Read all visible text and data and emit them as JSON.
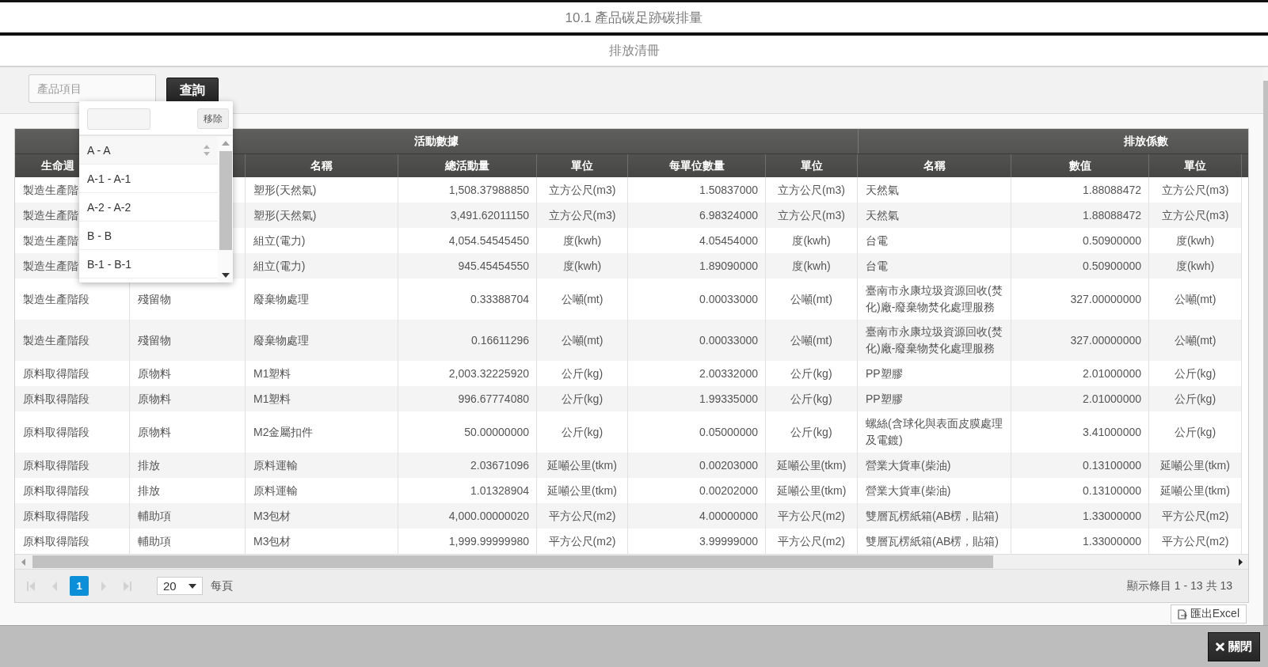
{
  "title_bar": {
    "title": "10.1 產品碳足跡碳排量"
  },
  "section": {
    "title": "排放清冊"
  },
  "filter": {
    "product_field": {
      "placeholder": "產品項目"
    },
    "query_button": "查詢"
  },
  "product_dropdown": {
    "remove_button": "移除",
    "options": [
      {
        "label": "A - A",
        "selected": true
      },
      {
        "label": "A-1 - A-1",
        "selected": false
      },
      {
        "label": "A-2 - A-2",
        "selected": false
      },
      {
        "label": "B - B",
        "selected": false
      },
      {
        "label": "B-1 - B-1",
        "selected": false
      }
    ]
  },
  "table": {
    "column_groups": [
      "活動數據",
      "排放係數"
    ],
    "columns": {
      "stage": "生命週",
      "activity_name": "名稱",
      "total_activity": "總活動量",
      "activity_unit": "單位",
      "quantity_per_unit": "每單位數量",
      "quantity_unit": "單位",
      "factor_name": "名稱",
      "factor_value": "數值",
      "factor_unit": "單位"
    },
    "rows": [
      {
        "stage": "製造生產階",
        "activity_name": "塑形(天然氣)",
        "total_activity": "1,508.37988850",
        "activity_unit": "立方公尺(m3)",
        "quantity_per_unit": "1.50837000",
        "quantity_unit": "立方公尺(m3)",
        "factor_name": "天然氣",
        "factor_value": "1.88088472",
        "factor_unit": "立方公尺(m3)"
      },
      {
        "stage": "製造生產階",
        "activity_name": "塑形(天然氣)",
        "total_activity": "3,491.62011150",
        "activity_unit": "立方公尺(m3)",
        "quantity_per_unit": "6.98324000",
        "quantity_unit": "立方公尺(m3)",
        "factor_name": "天然氣",
        "factor_value": "1.88088472",
        "factor_unit": "立方公尺(m3)"
      },
      {
        "stage": "製造生產階",
        "activity_name": "組立(電力)",
        "total_activity": "4,054.54545450",
        "activity_unit": "度(kwh)",
        "quantity_per_unit": "4.05454000",
        "quantity_unit": "度(kwh)",
        "factor_name": "台電",
        "factor_value": "0.50900000",
        "factor_unit": "度(kwh)"
      },
      {
        "stage": "製造生產階",
        "activity_name": "組立(電力)",
        "total_activity": "945.45454550",
        "activity_unit": "度(kwh)",
        "quantity_per_unit": "1.89090000",
        "quantity_unit": "度(kwh)",
        "factor_name": "台電",
        "factor_value": "0.50900000",
        "factor_unit": "度(kwh)"
      },
      {
        "stage": "製造生產階段",
        "column_2": "殘留物",
        "activity_name": "廢棄物處理",
        "total_activity": "0.33388704",
        "activity_unit": "公噸(mt)",
        "quantity_per_unit": "0.00033000",
        "quantity_unit": "公噸(mt)",
        "factor_name": "臺南市永康垃圾資源回收(焚化)廠-廢棄物焚化處理服務",
        "factor_value": "327.00000000",
        "factor_unit": "公噸(mt)"
      },
      {
        "stage": "製造生產階段",
        "column_2": "殘留物",
        "activity_name": "廢棄物處理",
        "total_activity": "0.16611296",
        "activity_unit": "公噸(mt)",
        "quantity_per_unit": "0.00033000",
        "quantity_unit": "公噸(mt)",
        "factor_name": "臺南市永康垃圾資源回收(焚化)廠-廢棄物焚化處理服務",
        "factor_value": "327.00000000",
        "factor_unit": "公噸(mt)"
      },
      {
        "stage": "原料取得階段",
        "column_2": "原物料",
        "activity_name": "M1塑料",
        "total_activity": "2,003.32225920",
        "activity_unit": "公斤(kg)",
        "quantity_per_unit": "2.00332000",
        "quantity_unit": "公斤(kg)",
        "factor_name": "PP塑膠",
        "factor_value": "2.01000000",
        "factor_unit": "公斤(kg)"
      },
      {
        "stage": "原料取得階段",
        "column_2": "原物料",
        "activity_name": "M1塑料",
        "total_activity": "996.67774080",
        "activity_unit": "公斤(kg)",
        "quantity_per_unit": "1.99335000",
        "quantity_unit": "公斤(kg)",
        "factor_name": "PP塑膠",
        "factor_value": "2.01000000",
        "factor_unit": "公斤(kg)"
      },
      {
        "stage": "原料取得階段",
        "column_2": "原物料",
        "activity_name": "M2金屬扣件",
        "total_activity": "50.00000000",
        "activity_unit": "公斤(kg)",
        "quantity_per_unit": "0.05000000",
        "quantity_unit": "公斤(kg)",
        "factor_name": "螺絲(含球化與表面皮膜處理及電鍍)",
        "factor_value": "3.41000000",
        "factor_unit": "公斤(kg)"
      },
      {
        "stage": "原料取得階段",
        "column_2": "排放",
        "activity_name": "原料運輸",
        "total_activity": "2.03671096",
        "activity_unit": "延噸公里(tkm)",
        "quantity_per_unit": "0.00203000",
        "quantity_unit": "延噸公里(tkm)",
        "factor_name": "營業大貨車(柴油)",
        "factor_value": "0.13100000",
        "factor_unit": "延噸公里(tkm)"
      },
      {
        "stage": "原料取得階段",
        "column_2": "排放",
        "activity_name": "原料運輸",
        "total_activity": "1.01328904",
        "activity_unit": "延噸公里(tkm)",
        "quantity_per_unit": "0.00202000",
        "quantity_unit": "延噸公里(tkm)",
        "factor_name": "營業大貨車(柴油)",
        "factor_value": "0.13100000",
        "factor_unit": "延噸公里(tkm)"
      },
      {
        "stage": "原料取得階段",
        "column_2": "輔助項",
        "activity_name": "M3包材",
        "total_activity": "4,000.00000020",
        "activity_unit": "平方公尺(m2)",
        "quantity_per_unit": "4.00000000",
        "quantity_unit": "平方公尺(m2)",
        "factor_name": "雙層瓦楞紙箱(AB楞，貼箱)",
        "factor_value": "1.33000000",
        "factor_unit": "平方公尺(m2)"
      },
      {
        "stage": "原料取得階段",
        "column_2": "輔助項",
        "activity_name": "M3包材",
        "total_activity": "1,999.99999980",
        "activity_unit": "平方公尺(m2)",
        "quantity_per_unit": "3.99999000",
        "quantity_unit": "平方公尺(m2)",
        "factor_name": "雙層瓦楞紙箱(AB楞，貼箱)",
        "factor_value": "1.33000000",
        "factor_unit": "平方公尺(m2)"
      }
    ]
  },
  "pagination": {
    "nav_buttons": [
      {
        "kind": "first",
        "disabled": true
      },
      {
        "kind": "previous",
        "disabled": true
      },
      {
        "kind": "next",
        "disabled": true
      },
      {
        "kind": "last",
        "disabled": true
      }
    ],
    "pages": [
      {
        "label": "1",
        "selected": true
      }
    ],
    "page_size": "20",
    "page_size_label": "每頁",
    "summary": "顯示條目 1 - 13 共 13"
  },
  "export_button": "匯出Excel",
  "footer": {
    "close_button": "關閉"
  }
}
